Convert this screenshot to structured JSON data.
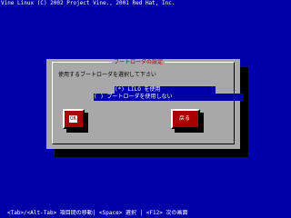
{
  "header": {
    "copyright": "Vine Linux (C) 2002 Project Vine., 2001 Red Hat, Inc."
  },
  "dialog": {
    "title": "ブートローダの設定",
    "prompt": "使用するブートローダを選択して下さい",
    "options": [
      {
        "label": "(*) LILO を使用",
        "selected": true
      },
      {
        "label": "( ) ブートローダを使用しない",
        "selected": false
      }
    ],
    "buttons": {
      "ok": "OK",
      "back": "戻る"
    }
  },
  "footer": {
    "help": "<Tab>/<Alt-Tab> 項目間の移動| <Space> 選択 | <F12> 次の画面"
  },
  "colors": {
    "background": "#0000a8",
    "dialog": "#a8a8a8",
    "title": "#a80000",
    "button": "#a80000"
  }
}
